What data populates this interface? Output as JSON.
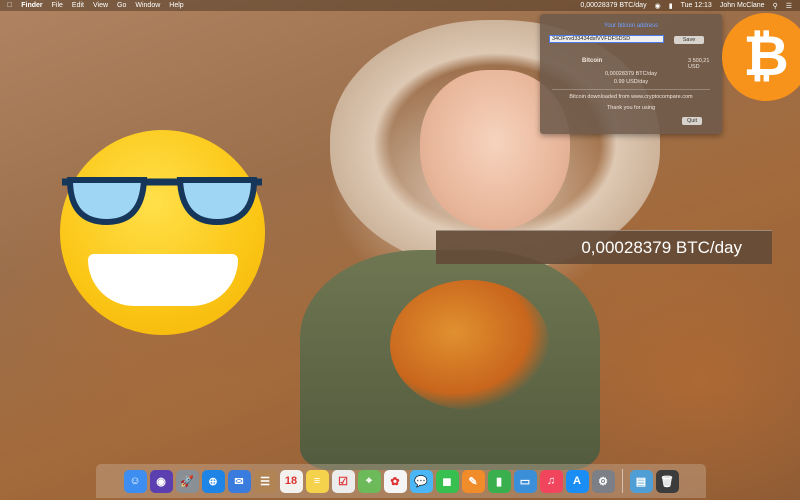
{
  "menubar": {
    "apple_icon": "apple-icon",
    "app_name": "Finder",
    "menus": [
      "File",
      "Edit",
      "View",
      "Go",
      "Window",
      "Help"
    ],
    "status_rate": "0,00028379 BTC/day",
    "clock": "Tue 12:13",
    "user": "John McClane"
  },
  "popup": {
    "title": "Your bitcoin address",
    "address_value": "34ÕFvvd33434dsfVVFDFSDSD",
    "save_label": "Save",
    "coin_name": "Bitcoin",
    "usd_price": "3 500,21 USD",
    "btc_per_day": "0,00028379 BTC/day",
    "usd_per_day": "0.99 USD/day",
    "source_text": "Bitcoin downloaded  from www.cryptocompare.com",
    "thanks_text": "Thank you for using",
    "quit_label": "Quit"
  },
  "btc_logo": {
    "symbol": "₿",
    "color": "#f7931a"
  },
  "ticker": {
    "text": "0,00028379 BTC/day"
  },
  "dock": {
    "icons": [
      {
        "name": "finder-icon",
        "color": "#3d8ef0",
        "glyph": "☺"
      },
      {
        "name": "siri-icon",
        "color": "#5b3fb0",
        "glyph": "◉"
      },
      {
        "name": "launchpad-icon",
        "color": "#8a8f96",
        "glyph": "🚀"
      },
      {
        "name": "safari-icon",
        "color": "#1e84e6",
        "glyph": "⊕"
      },
      {
        "name": "mail-icon",
        "color": "#3a7cdd",
        "glyph": "✉"
      },
      {
        "name": "contacts-icon",
        "color": "#b08455",
        "glyph": "☰"
      },
      {
        "name": "calendar-icon",
        "color": "#f3f1ee",
        "glyph": "18"
      },
      {
        "name": "notes-icon",
        "color": "#f5d24c",
        "glyph": "≡"
      },
      {
        "name": "reminders-icon",
        "color": "#ececec",
        "glyph": "☑"
      },
      {
        "name": "maps-icon",
        "color": "#6cba5a",
        "glyph": "⌖"
      },
      {
        "name": "photos-icon",
        "color": "#f5f5f5",
        "glyph": "✿"
      },
      {
        "name": "messages-icon",
        "color": "#4bb6f5",
        "glyph": "💬"
      },
      {
        "name": "facetime-icon",
        "color": "#37c04f",
        "glyph": "◼"
      },
      {
        "name": "pages-icon",
        "color": "#f08c2a",
        "glyph": "✎"
      },
      {
        "name": "numbers-icon",
        "color": "#39b04d",
        "glyph": "▮"
      },
      {
        "name": "keynote-icon",
        "color": "#3b8ed8",
        "glyph": "▭"
      },
      {
        "name": "music-icon",
        "color": "#f0455d",
        "glyph": "♫"
      },
      {
        "name": "app-store-icon",
        "color": "#1a8ef5",
        "glyph": "A"
      },
      {
        "name": "system-preferences-icon",
        "color": "#7c7f86",
        "glyph": "⚙"
      },
      {
        "name": "downloads-folder-icon",
        "color": "#4f9fd6",
        "glyph": "▤"
      },
      {
        "name": "trash-icon",
        "color": "#3c3c3c",
        "glyph": "🗑"
      }
    ]
  }
}
